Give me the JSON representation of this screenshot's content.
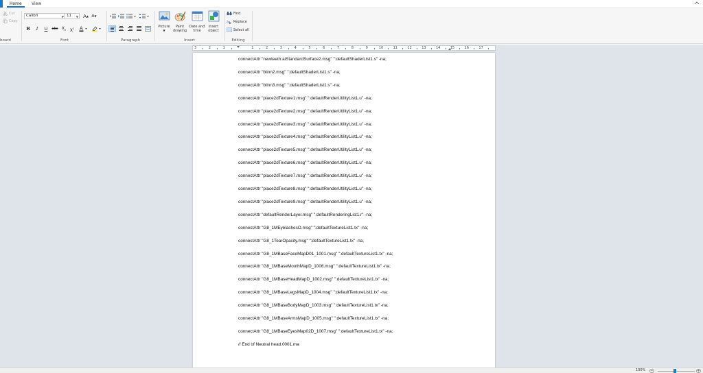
{
  "tabs": [
    {
      "label": "Home",
      "active": true
    },
    {
      "label": "View",
      "active": false
    }
  ],
  "ribbon": {
    "clipboard": {
      "group_label": "board",
      "cut": "Cut",
      "copy": "Copy"
    },
    "font": {
      "group_label": "Font",
      "family": "Calibri",
      "size": "11",
      "bold": "B",
      "italic": "I",
      "underline": "U",
      "strike": "abc"
    },
    "paragraph": {
      "group_label": "Paragraph"
    },
    "insert": {
      "group_label": "Insert",
      "picture": "Picture",
      "paint": "Paint\ndrawing",
      "datetime": "Date and\ntime",
      "object": "Insert\nobject"
    },
    "editing": {
      "group_label": "Editing",
      "find": "Find",
      "replace": "Replace",
      "select_all": "Select all"
    }
  },
  "ruler_labels": [
    "3",
    "2",
    "1",
    "1",
    "2",
    "3",
    "4",
    "5",
    "6",
    "7",
    "8",
    "9",
    "10",
    "11",
    "12",
    "13",
    "14",
    "15",
    "16",
    "17"
  ],
  "document": {
    "lines": [
      "connectAttr \"newteeth:aiStandardSurface2.msg\" \":defaultShaderList1.s\" -na;",
      "connectAttr \"blinn2.msg\" \":defaultShaderList1.s\" -na;",
      "connectAttr \"blinn3.msg\" \":defaultShaderList1.s\" -na;",
      "connectAttr \"place2dTexture1.msg\" \":defaultRenderUtilityList1.u\" -na;",
      "connectAttr \"place2dTexture2.msg\" \":defaultRenderUtilityList1.u\" -na;",
      "connectAttr \"place2dTexture3.msg\" \":defaultRenderUtilityList1.u\" -na;",
      "connectAttr \"place2dTexture4.msg\" \":defaultRenderUtilityList1.u\" -na;",
      "connectAttr \"place2dTexture5.msg\" \":defaultRenderUtilityList1.u\" -na;",
      "connectAttr \"place2dTexture6.msg\" \":defaultRenderUtilityList1.u\" -na;",
      "connectAttr \"place2dTexture7.msg\" \":defaultRenderUtilityList1.u\" -na;",
      "connectAttr \"place2dTexture8.msg\" \":defaultRenderUtilityList1.u\" -na;",
      "connectAttr \"place2dTexture9.msg\" \":defaultRenderUtilityList1.u\" -na;",
      "connectAttr \"defaultRenderLayer.msg\" \":defaultRenderingList1.r\" -na;",
      "connectAttr \"G8_1MEyelashesO.msg\" \":defaultTextureList1.tx\" -na;",
      "connectAttr \"G8_1TearOpacity.msg\" \":defaultTextureList1.tx\" -na;",
      "connectAttr \"G8_1MBaseFaceMapD01_1001.msg\" \":defaultTextureList1.tx\" -na;",
      "connectAttr \"G8_1MBaseMouthMapD_1006.msg\" \":defaultTextureList1.tx\" -na;",
      "connectAttr \"G8_1MBaseHeadMapD_1002.msg\" \":defaultTextureList1.tx\" -na;",
      "connectAttr \"G8_1MBaseLegsMapD_1004.msg\" \":defaultTextureList1.tx\" -na;",
      "connectAttr \"G8_1MBaseBodyMapD_1003.msg\" \":defaultTextureList1.tx\" -na;",
      "connectAttr \"G8_1MBaseArmsMapD_1005.msg\" \":defaultTextureList1.tx\" -na;",
      "connectAttr \"G8_1MBaseEyesMap02D_1007.msg\" \":defaultTextureList1.tx\" -na;",
      "// End of Neutral head.0001.ma"
    ]
  },
  "status": {
    "zoom": "100%",
    "zoom_fraction": 0.46
  },
  "colors": {
    "accent": "#1979ca",
    "canvas": "#dfe4ea",
    "ribbon": "#f6f6f6"
  }
}
